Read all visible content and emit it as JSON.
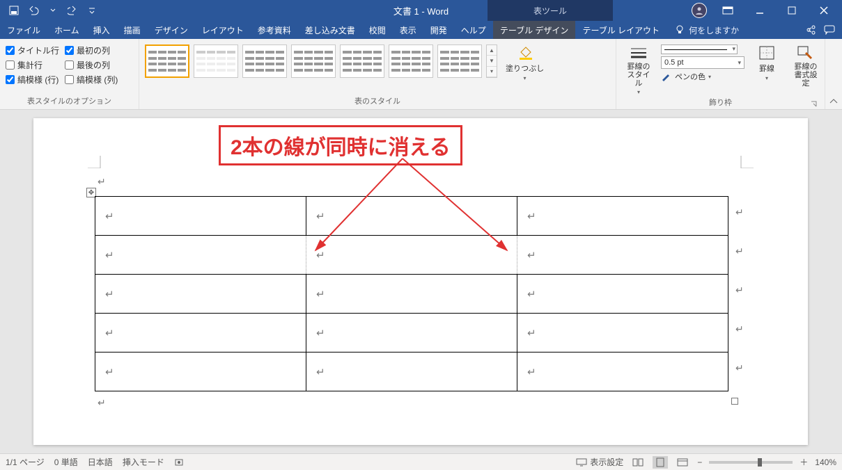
{
  "title": "文書 1  -  Word",
  "context_tab": "表ツール",
  "qat": {
    "save": "保存",
    "undo": "元に戻す",
    "redo": "やり直し"
  },
  "tabs": {
    "file": "ファイル",
    "home": "ホーム",
    "insert": "挿入",
    "draw": "描画",
    "design": "デザイン",
    "layout": "レイアウト",
    "references": "参考資料",
    "mailings": "差し込み文書",
    "review": "校閲",
    "view": "表示",
    "developer": "開発",
    "help": "ヘルプ",
    "table_design": "テーブル デザイン",
    "table_layout": "テーブル レイアウト"
  },
  "tell_me": "何をしますか",
  "ribbon": {
    "options_group": "表スタイルのオプション",
    "chk_header": "タイトル行",
    "chk_first_col": "最初の列",
    "chk_total": "集計行",
    "chk_last_col": "最後の列",
    "chk_banded_row": "縞模様 (行)",
    "chk_banded_col": "縞模様 (列)",
    "styles_group": "表のスタイル",
    "shading": "塗りつぶし",
    "borders_group": "飾り枠",
    "border_styles": "罫線の\nスタイル",
    "pt": "0.5 pt",
    "pen_color": "ペンの色",
    "borders": "罫線",
    "border_painter": "罫線の\n書式設定"
  },
  "annotation": "2本の線が同時に消える",
  "status": {
    "page": "1/1 ページ",
    "words": "0 単語",
    "lang": "日本語",
    "mode": "挿入モード",
    "display": "表示設定",
    "zoom": "140%"
  }
}
